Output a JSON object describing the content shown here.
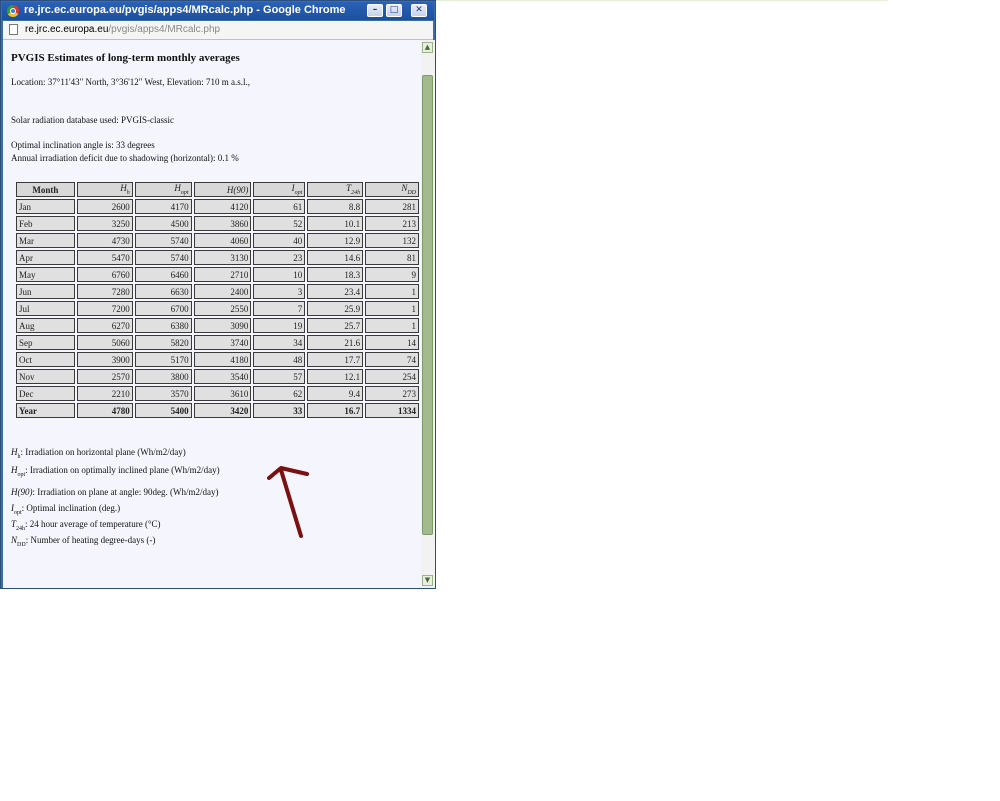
{
  "window": {
    "title": "re.jrc.ec.europa.eu/pvgis/apps4/MRcalc.php - Google Chrome",
    "controls": {
      "minimize": "–",
      "maximize": "□",
      "close": "✕"
    }
  },
  "address": {
    "host": "re.jrc.ec.europa.eu",
    "path": "/pvgis/apps4/MRcalc.php"
  },
  "page": {
    "heading": "PVGIS Estimates of long-term monthly averages",
    "location": "Location: 37°11'43\" North, 3°36'12\" West, Elevation: 710 m a.s.l.,",
    "database": "Solar radiation database used: PVGIS-classic",
    "optimal": "Optimal inclination angle is: 33 degrees",
    "deficit": "Annual irradiation deficit due to shadowing (horizontal): 0.1 %"
  },
  "table": {
    "headers": [
      "Month",
      "H_h",
      "H_opt",
      "H(90)",
      "I_opt",
      "T_24h",
      "N_DD"
    ],
    "rows": [
      [
        "Jan",
        "2600",
        "4170",
        "4120",
        "61",
        "8.8",
        "281"
      ],
      [
        "Feb",
        "3250",
        "4500",
        "3860",
        "52",
        "10.1",
        "213"
      ],
      [
        "Mar",
        "4730",
        "5740",
        "4060",
        "40",
        "12.9",
        "132"
      ],
      [
        "Apr",
        "5470",
        "5740",
        "3130",
        "23",
        "14.6",
        "81"
      ],
      [
        "May",
        "6760",
        "6460",
        "2710",
        "10",
        "18.3",
        "9"
      ],
      [
        "Jun",
        "7280",
        "6630",
        "2400",
        "3",
        "23.4",
        "1"
      ],
      [
        "Jul",
        "7200",
        "6700",
        "2550",
        "7",
        "25.9",
        "1"
      ],
      [
        "Aug",
        "6270",
        "6380",
        "3090",
        "19",
        "25.7",
        "1"
      ],
      [
        "Sep",
        "5060",
        "5820",
        "3740",
        "34",
        "21.6",
        "14"
      ],
      [
        "Oct",
        "3900",
        "5170",
        "4180",
        "48",
        "17.7",
        "74"
      ],
      [
        "Nov",
        "2570",
        "3800",
        "3540",
        "57",
        "12.1",
        "254"
      ],
      [
        "Dec",
        "2210",
        "3570",
        "3610",
        "62",
        "9.4",
        "273"
      ],
      [
        "Year",
        "4780",
        "5400",
        "3420",
        "33",
        "16.7",
        "1334"
      ]
    ]
  },
  "legend": {
    "hh": ": Irradiation on horizontal plane (Wh/m2/day)",
    "hopt": ": Irradiation on optimally inclined plane (Wh/m2/day)",
    "h90": ": Irradiation on plane at angle: 90deg. (Wh/m2/day)",
    "iopt": ": Optimal inclination (deg.)",
    "t24": ": 24 hour average of temperature (°C)",
    "ndd": ": Number of heating degree-days (-)"
  },
  "annotation": {
    "arrow_color": "#7a1010"
  }
}
